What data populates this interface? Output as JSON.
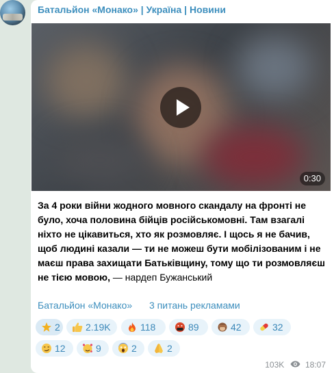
{
  "channel": {
    "title": "Батальйон «Монако» | Україна | Новини"
  },
  "video": {
    "duration": "0:30"
  },
  "post": {
    "text_bold": "За 4 роки війни жодного мовного скандалу на фронті не було, хоча половина бійців російськомовні. Там взагалі ніхто не цікавиться, хто як розмовляє. І щось я не бачив, щоб людині казали — ти не можеш бути мобілізованим і не маєш права захищати Батьківщину, тому що ти розмовляєш не тією мовою,",
    "text_regular": " — нардеп Бужанський"
  },
  "links": {
    "channel_link": "Батальйон «Монако»",
    "ads_link": "3 питань рекламами"
  },
  "reactions": [
    {
      "icon": "star-icon",
      "count": "2"
    },
    {
      "icon": "thumbs-up-icon",
      "count": "2.19K"
    },
    {
      "icon": "fire-icon",
      "count": "118"
    },
    {
      "icon": "cursing-face-icon",
      "count": "89"
    },
    {
      "icon": "see-no-evil-monkey-icon",
      "count": "42"
    },
    {
      "icon": "pill-icon",
      "count": "32"
    },
    {
      "icon": "smirk-face-icon",
      "count": "12"
    },
    {
      "icon": "smiling-hearts-face-icon",
      "count": "9"
    },
    {
      "icon": "screaming-face-icon",
      "count": "2"
    },
    {
      "icon": "folded-hands-icon",
      "count": "2"
    }
  ],
  "meta": {
    "views": "103K",
    "time": "18:07"
  },
  "colors": {
    "link": "#3c8ebd",
    "reaction_bg": "#e8f3fa",
    "page_bg": "#dfe8e1"
  }
}
